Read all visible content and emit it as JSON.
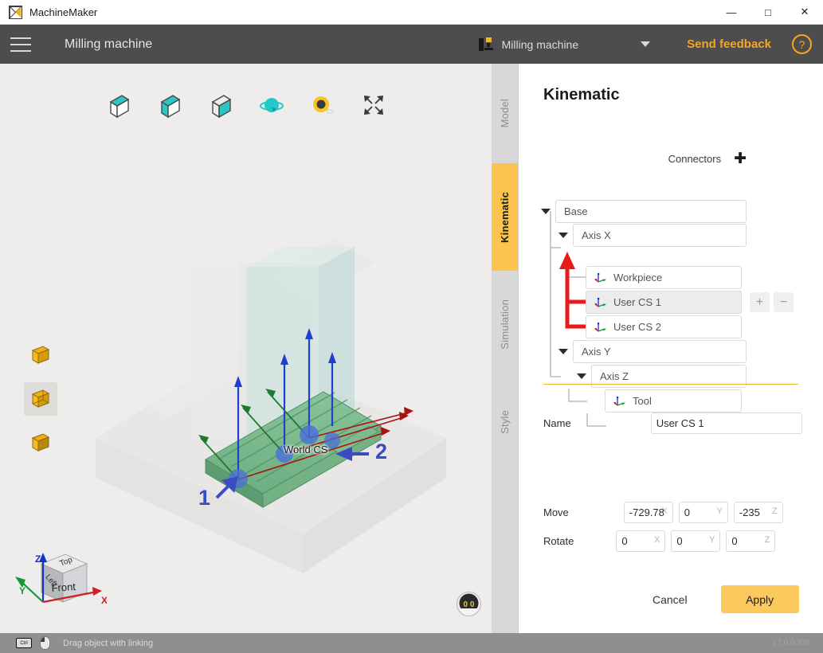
{
  "window": {
    "app_title": "MachineMaker",
    "logo_icon": "machinemaker-logo-icon",
    "minimize_label": "—",
    "maximize_label": "□",
    "close_label": "✕"
  },
  "appbar": {
    "menu_icon": "hamburger-menu-icon",
    "title": "Milling machine",
    "machine_icon": "milling-machine-icon",
    "machine_name": "Milling machine",
    "dropdown_icon": "chevron-down-icon",
    "feedback_label": "Send feedback",
    "help_label": "?"
  },
  "viewport": {
    "tools": [
      {
        "name": "view-hidden-lines-icon",
        "label": "Hidden lines"
      },
      {
        "name": "view-shaded-icon",
        "label": "Shaded"
      },
      {
        "name": "view-wireframe-icon",
        "label": "Wireframe"
      },
      {
        "name": "orbit-rotate-icon",
        "label": "Rotate"
      },
      {
        "name": "measure-tape-icon",
        "label": "Measure"
      },
      {
        "name": "fit-to-screen-icon",
        "label": "Fit to screen"
      }
    ],
    "left_tools": [
      {
        "name": "display-mode-solid-icon",
        "selected": false
      },
      {
        "name": "display-mode-transparent-icon",
        "selected": true
      },
      {
        "name": "display-mode-ghost-icon",
        "selected": false
      }
    ],
    "world_cs_label": "World CS",
    "annotation_1": "1",
    "annotation_2": "2",
    "nav_cube": {
      "front": "Front",
      "left": "Left",
      "top": "Top",
      "axis_x": "X",
      "axis_y": "Y",
      "axis_z": "Z"
    },
    "orientation_indicator": "0 0"
  },
  "tabs": [
    {
      "label": "Model",
      "active": false
    },
    {
      "label": "Kinematic",
      "active": true
    },
    {
      "label": "Simulation",
      "active": false
    },
    {
      "label": "Style",
      "active": false
    }
  ],
  "panel": {
    "title": "Kinematic",
    "connectors_label": "Connectors",
    "add_connector_icon": "plus-icon",
    "tree": [
      {
        "label": "Base",
        "depth": 0,
        "expandable": true,
        "has_cs_icon": false,
        "selected": false
      },
      {
        "label": "Axis X",
        "depth": 1,
        "expandable": true,
        "has_cs_icon": false,
        "selected": false
      },
      {
        "label": "Workpiece",
        "depth": 2,
        "expandable": false,
        "has_cs_icon": true,
        "selected": false
      },
      {
        "label": "User CS 1",
        "depth": 2,
        "expandable": false,
        "has_cs_icon": true,
        "selected": true
      },
      {
        "label": "User CS 2",
        "depth": 2,
        "expandable": false,
        "has_cs_icon": true,
        "selected": false
      },
      {
        "label": "Axis Y",
        "depth": 1,
        "expandable": true,
        "has_cs_icon": false,
        "selected": false
      },
      {
        "label": "Axis Z",
        "depth": 2,
        "expandable": true,
        "has_cs_icon": false,
        "selected": false
      },
      {
        "label": "Tool",
        "depth": 3,
        "expandable": false,
        "has_cs_icon": true,
        "selected": false
      }
    ],
    "add_item_label": "+",
    "remove_item_label": "−",
    "name_label": "Name",
    "name_value": "User CS 1",
    "move_label": "Move",
    "move": {
      "x": "-729.78",
      "y": "0",
      "z": "-235",
      "x_axis": "X",
      "y_axis": "Y",
      "z_axis": "Z"
    },
    "rotate_label": "Rotate",
    "rotate": {
      "x": "0",
      "y": "0",
      "z": "0",
      "x_axis": "X",
      "y_axis": "Y",
      "z_axis": "Z"
    },
    "cancel_label": "Cancel",
    "apply_label": "Apply"
  },
  "statusbar": {
    "key_icon": "ctrl-key-icon",
    "key_label": "Ctrl",
    "mouse_icon": "mouse-left-button-icon",
    "hint": "Drag object with linking",
    "version": "17.0.0.938"
  },
  "colors": {
    "accent": "#f5a623",
    "tab_active": "#fac44d",
    "apply": "#fbc95d",
    "appbar": "#4d4d4d",
    "viewport_bg": "#eeedeb",
    "annotation": "#3b4cc0",
    "tree_annotation": "#e81b1b"
  }
}
